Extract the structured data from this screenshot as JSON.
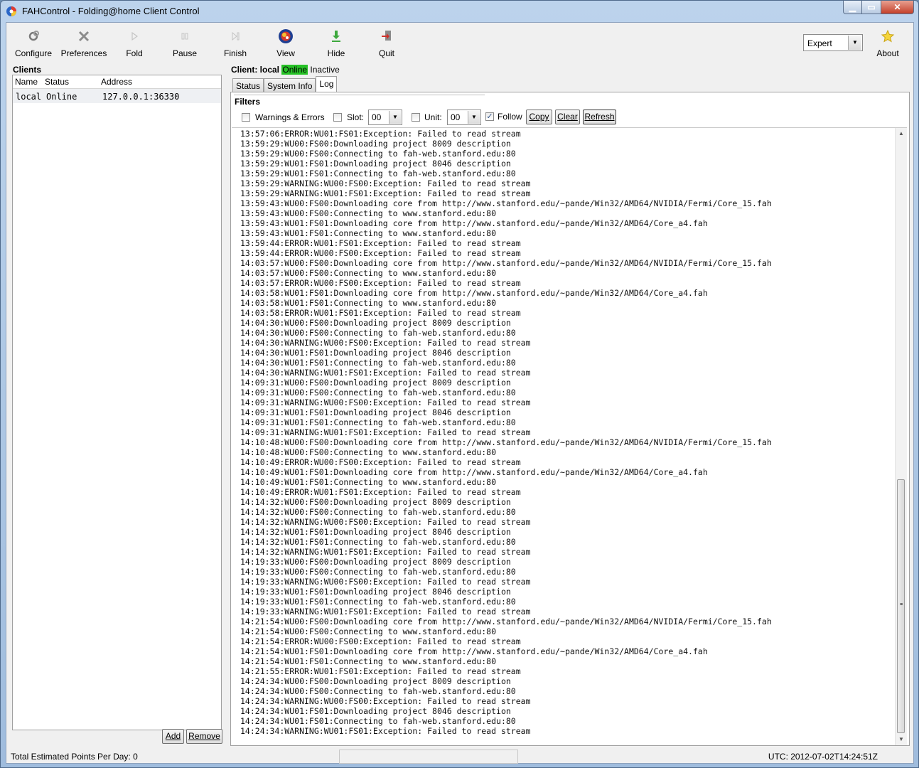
{
  "window": {
    "title": "FAHControl - Folding@home Client Control",
    "min_glyph": "▁",
    "max_glyph": "▭",
    "close_glyph": "✕"
  },
  "toolbar": {
    "configure": "Configure",
    "preferences": "Preferences",
    "fold": "Fold",
    "pause": "Pause",
    "finish": "Finish",
    "view": "View",
    "hide": "Hide",
    "quit": "Quit",
    "mode": "Expert",
    "about": "About"
  },
  "clients_panel": {
    "title": "Clients",
    "columns": [
      "Name",
      "Status",
      "Address"
    ],
    "rows": [
      {
        "name": "local",
        "status": "Online",
        "address": "127.0.0.1:36330"
      }
    ],
    "add_label": "Add",
    "remove_label": "Remove"
  },
  "client_view": {
    "prefix": "Client: local",
    "status": "Online",
    "state": "Inactive",
    "tabs": [
      "Status",
      "System Info",
      "Log"
    ],
    "active_tab": "Log"
  },
  "filters": {
    "title": "Filters",
    "warnings_errors_label": "Warnings & Errors",
    "warnings_errors_checked": false,
    "slot_label": "Slot:",
    "slot_value": "00",
    "slot_checked": false,
    "unit_label": "Unit:",
    "unit_value": "00",
    "unit_checked": false,
    "follow_label": "Follow",
    "follow_checked": true,
    "copy_label": "Copy",
    "clear_label": "Clear",
    "refresh_label": "Refresh"
  },
  "log_lines": [
    "13:57:06:ERROR:WU01:FS01:Exception: Failed to read stream",
    "13:59:29:WU00:FS00:Downloading project 8009 description",
    "13:59:29:WU00:FS00:Connecting to fah-web.stanford.edu:80",
    "13:59:29:WU01:FS01:Downloading project 8046 description",
    "13:59:29:WU01:FS01:Connecting to fah-web.stanford.edu:80",
    "13:59:29:WARNING:WU00:FS00:Exception: Failed to read stream",
    "13:59:29:WARNING:WU01:FS01:Exception: Failed to read stream",
    "13:59:43:WU00:FS00:Downloading core from http://www.stanford.edu/~pande/Win32/AMD64/NVIDIA/Fermi/Core_15.fah",
    "13:59:43:WU00:FS00:Connecting to www.stanford.edu:80",
    "13:59:43:WU01:FS01:Downloading core from http://www.stanford.edu/~pande/Win32/AMD64/Core_a4.fah",
    "13:59:43:WU01:FS01:Connecting to www.stanford.edu:80",
    "13:59:44:ERROR:WU01:FS01:Exception: Failed to read stream",
    "13:59:44:ERROR:WU00:FS00:Exception: Failed to read stream",
    "14:03:57:WU00:FS00:Downloading core from http://www.stanford.edu/~pande/Win32/AMD64/NVIDIA/Fermi/Core_15.fah",
    "14:03:57:WU00:FS00:Connecting to www.stanford.edu:80",
    "14:03:57:ERROR:WU00:FS00:Exception: Failed to read stream",
    "14:03:58:WU01:FS01:Downloading core from http://www.stanford.edu/~pande/Win32/AMD64/Core_a4.fah",
    "14:03:58:WU01:FS01:Connecting to www.stanford.edu:80",
    "14:03:58:ERROR:WU01:FS01:Exception: Failed to read stream",
    "14:04:30:WU00:FS00:Downloading project 8009 description",
    "14:04:30:WU00:FS00:Connecting to fah-web.stanford.edu:80",
    "14:04:30:WARNING:WU00:FS00:Exception: Failed to read stream",
    "14:04:30:WU01:FS01:Downloading project 8046 description",
    "14:04:30:WU01:FS01:Connecting to fah-web.stanford.edu:80",
    "14:04:30:WARNING:WU01:FS01:Exception: Failed to read stream",
    "14:09:31:WU00:FS00:Downloading project 8009 description",
    "14:09:31:WU00:FS00:Connecting to fah-web.stanford.edu:80",
    "14:09:31:WARNING:WU00:FS00:Exception: Failed to read stream",
    "14:09:31:WU01:FS01:Downloading project 8046 description",
    "14:09:31:WU01:FS01:Connecting to fah-web.stanford.edu:80",
    "14:09:31:WARNING:WU01:FS01:Exception: Failed to read stream",
    "14:10:48:WU00:FS00:Downloading core from http://www.stanford.edu/~pande/Win32/AMD64/NVIDIA/Fermi/Core_15.fah",
    "14:10:48:WU00:FS00:Connecting to www.stanford.edu:80",
    "14:10:49:ERROR:WU00:FS00:Exception: Failed to read stream",
    "14:10:49:WU01:FS01:Downloading core from http://www.stanford.edu/~pande/Win32/AMD64/Core_a4.fah",
    "14:10:49:WU01:FS01:Connecting to www.stanford.edu:80",
    "14:10:49:ERROR:WU01:FS01:Exception: Failed to read stream",
    "14:14:32:WU00:FS00:Downloading project 8009 description",
    "14:14:32:WU00:FS00:Connecting to fah-web.stanford.edu:80",
    "14:14:32:WARNING:WU00:FS00:Exception: Failed to read stream",
    "14:14:32:WU01:FS01:Downloading project 8046 description",
    "14:14:32:WU01:FS01:Connecting to fah-web.stanford.edu:80",
    "14:14:32:WARNING:WU01:FS01:Exception: Failed to read stream",
    "14:19:33:WU00:FS00:Downloading project 8009 description",
    "14:19:33:WU00:FS00:Connecting to fah-web.stanford.edu:80",
    "14:19:33:WARNING:WU00:FS00:Exception: Failed to read stream",
    "14:19:33:WU01:FS01:Downloading project 8046 description",
    "14:19:33:WU01:FS01:Connecting to fah-web.stanford.edu:80",
    "14:19:33:WARNING:WU01:FS01:Exception: Failed to read stream",
    "14:21:54:WU00:FS00:Downloading core from http://www.stanford.edu/~pande/Win32/AMD64/NVIDIA/Fermi/Core_15.fah",
    "14:21:54:WU00:FS00:Connecting to www.stanford.edu:80",
    "14:21:54:ERROR:WU00:FS00:Exception: Failed to read stream",
    "14:21:54:WU01:FS01:Downloading core from http://www.stanford.edu/~pande/Win32/AMD64/Core_a4.fah",
    "14:21:54:WU01:FS01:Connecting to www.stanford.edu:80",
    "14:21:55:ERROR:WU01:FS01:Exception: Failed to read stream",
    "14:24:34:WU00:FS00:Downloading project 8009 description",
    "14:24:34:WU00:FS00:Connecting to fah-web.stanford.edu:80",
    "14:24:34:WARNING:WU00:FS00:Exception: Failed to read stream",
    "14:24:34:WU01:FS01:Downloading project 8046 description",
    "14:24:34:WU01:FS01:Connecting to fah-web.stanford.edu:80",
    "14:24:34:WARNING:WU01:FS01:Exception: Failed to read stream"
  ],
  "statusbar": {
    "points": "Total Estimated Points Per Day: 0",
    "utc": "UTC: 2012-07-02T14:24:51Z"
  },
  "icons": {
    "configure": "gear-link-icon",
    "preferences": "tools-icon",
    "fold": "play-icon",
    "pause": "pause-icon",
    "finish": "finish-icon",
    "view": "protein-view-icon",
    "hide": "hide-down-arrow-icon",
    "quit": "quit-door-icon",
    "about": "star-icon"
  },
  "colors": {
    "online_badge": "#27c227",
    "window_frame": "#a9c4e4"
  }
}
